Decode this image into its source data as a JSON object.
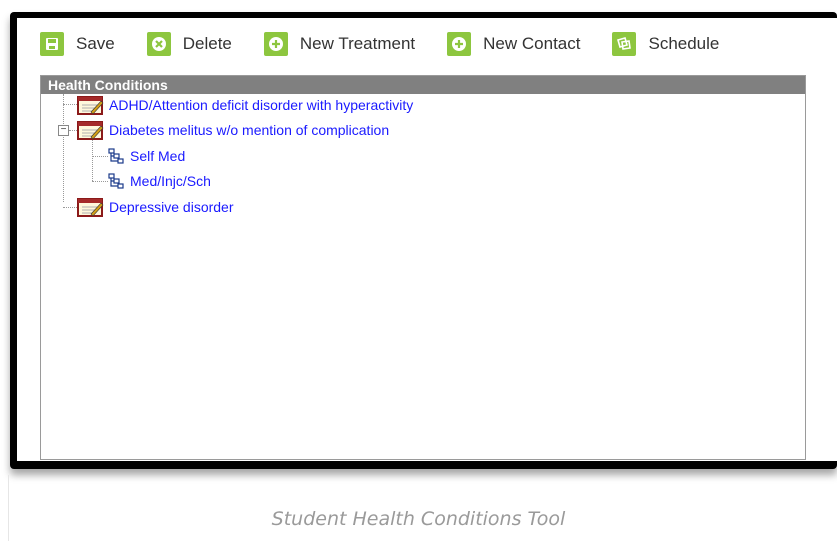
{
  "toolbar": {
    "save_label": "Save",
    "delete_label": "Delete",
    "new_treatment_label": "New Treatment",
    "new_contact_label": "New Contact",
    "schedule_label": "Schedule"
  },
  "panel": {
    "title": "Health Conditions"
  },
  "tree": {
    "conditions": [
      {
        "label": "ADHD/Attention deficit disorder with hyperactivity"
      },
      {
        "label": "Diabetes melitus w/o mention of complication",
        "children": [
          {
            "label": "Self Med"
          },
          {
            "label": "Med/Injc/Sch"
          }
        ]
      },
      {
        "label": "Depressive disorder"
      }
    ]
  },
  "caption": "Student Health Conditions Tool",
  "colors": {
    "accent_green": "#8dc63f",
    "header_gray": "#808080",
    "link_blue": "#1a1aff"
  },
  "icons": {
    "save": "save-icon",
    "delete": "delete-icon",
    "add": "plus-icon",
    "schedule": "schedule-icon",
    "condition": "condition-notepad-icon",
    "medication": "hierarchy-icon"
  }
}
